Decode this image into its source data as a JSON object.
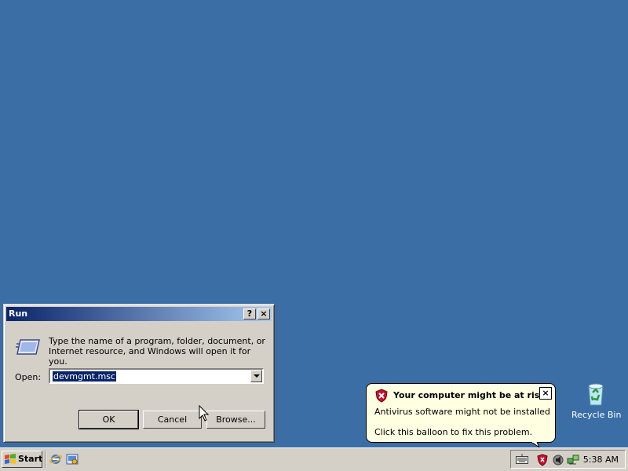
{
  "desktop": {
    "recycle_bin_label": "Recycle Bin",
    "background_color": "#3a6ea5"
  },
  "run_dialog": {
    "title": "Run",
    "help_button": "?",
    "close_button": "×",
    "description_line1": "Type the name of a program, folder, document, or",
    "description_line2": "Internet resource, and Windows will open it for you.",
    "open_label": "Open:",
    "open_value": "devmgmt.msc",
    "ok_label": "OK",
    "cancel_label": "Cancel",
    "browse_label": "Browse..."
  },
  "balloon": {
    "title": "Your computer might be at risk",
    "line1": "Antivirus software might not be installed",
    "line2": "Click this balloon to fix this problem.",
    "close": "×",
    "icon": "security-shield-icon"
  },
  "taskbar": {
    "start_label": "Start",
    "quick_launch": [
      "internet-explorer-icon",
      "show-desktop-icon"
    ],
    "tray_icons": [
      "keyboard-icon",
      "security-alert-icon",
      "volume-icon",
      "network-icon"
    ],
    "clock": "5:38 AM"
  }
}
